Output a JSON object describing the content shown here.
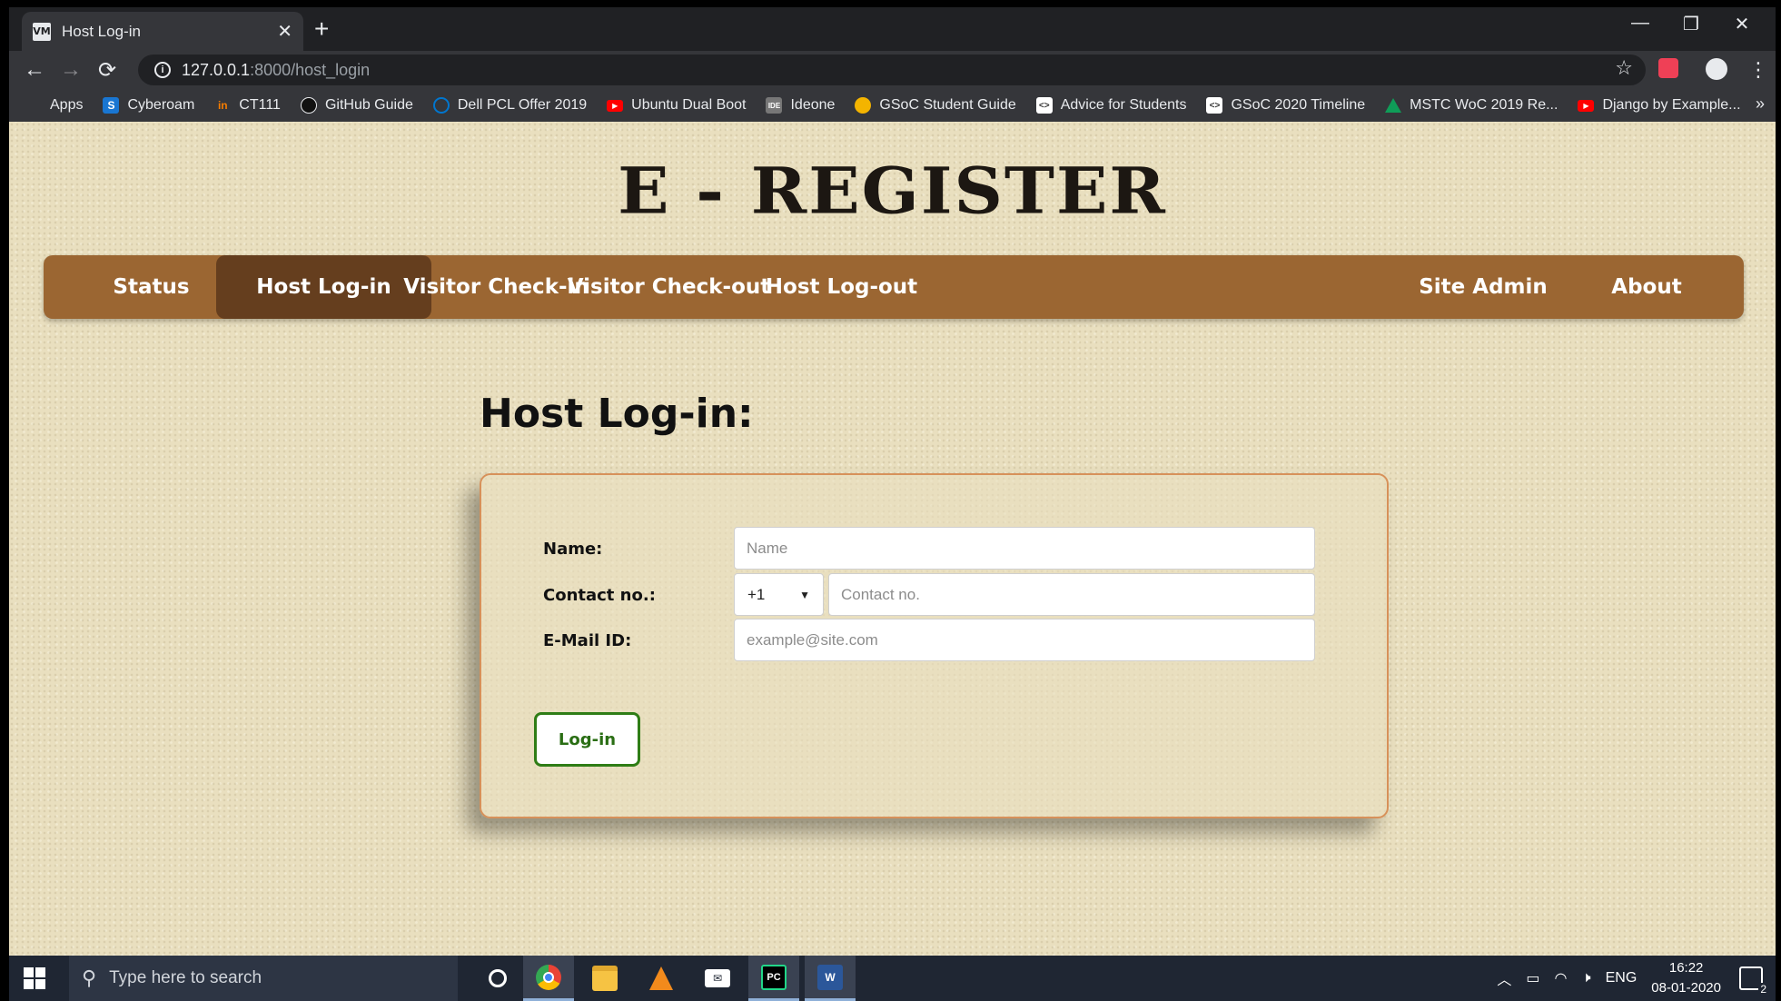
{
  "browser": {
    "tab_title": "Host Log-in",
    "favicon_text": "VM",
    "tab_close": "✕",
    "new_tab": "+",
    "minimize": "—",
    "restore": "❐",
    "close": "✕",
    "back_icon": "←",
    "forward_icon": "→",
    "reload_icon": "⟳",
    "url_host": "127.0.0.1",
    "url_path": ":8000/host_login",
    "star_icon": "☆",
    "menu_icon": "⋮",
    "bookmarks": [
      {
        "label": "Apps",
        "icon": "apps-grid-icon",
        "color": "#4285f4"
      },
      {
        "label": "Cyberoam",
        "icon": "cyberoam-icon",
        "color": "#1976d2"
      },
      {
        "label": "CT111",
        "icon": "ct111-icon",
        "color": "#f57c00"
      },
      {
        "label": "GitHub Guide",
        "icon": "github-icon",
        "color": "#111111"
      },
      {
        "label": "Dell PCL Offer 2019",
        "icon": "dell-icon",
        "color": "#0076ce"
      },
      {
        "label": "Ubuntu Dual Boot",
        "icon": "youtube-icon",
        "color": "#ff0000"
      },
      {
        "label": "Ideone",
        "icon": "ideone-icon",
        "color": "#777777"
      },
      {
        "label": "GSoC Student Guide",
        "icon": "gsoc-icon",
        "color": "#f4b400"
      },
      {
        "label": "Advice for Students",
        "icon": "code-icon",
        "color": "#ffffff"
      },
      {
        "label": "GSoC 2020 Timeline",
        "icon": "code-icon",
        "color": "#ffffff"
      },
      {
        "label": "MSTC WoC 2019 Re...",
        "icon": "google-drive-icon",
        "color": "#0f9d58"
      },
      {
        "label": "Django by Example...",
        "icon": "youtube-icon",
        "color": "#ff0000"
      }
    ],
    "bookmarks_more": "»"
  },
  "site": {
    "logo": "E - REGISTER",
    "nav": [
      {
        "label": "Status",
        "active": false
      },
      {
        "label": "Host Log-in",
        "active": true
      },
      {
        "label": "Visitor Check-in",
        "active": false
      },
      {
        "label": "Visitor Check-out",
        "active": false
      },
      {
        "label": "Host Log-out",
        "active": false
      },
      {
        "label": "Site Admin",
        "active": false
      },
      {
        "label": "About",
        "active": false
      }
    ]
  },
  "form": {
    "title": "Host Log-in:",
    "name_label": "Name:",
    "name_placeholder": "Name",
    "contact_label": "Contact no.:",
    "country_code": "+1",
    "caret": "▼",
    "contact_placeholder": "Contact no.",
    "email_label": "E-Mail ID:",
    "email_placeholder": "example@site.com",
    "submit_label": "Log-in"
  },
  "taskbar": {
    "search_placeholder": "Type here to search",
    "apps": [
      "cortana-icon",
      "chrome-icon",
      "file-explorer-icon",
      "vlc-icon",
      "mail-icon",
      "pycharm-icon",
      "word-icon"
    ],
    "lang": "ENG",
    "time": "16:22",
    "date": "08-01-2020",
    "notification_count": "2"
  }
}
